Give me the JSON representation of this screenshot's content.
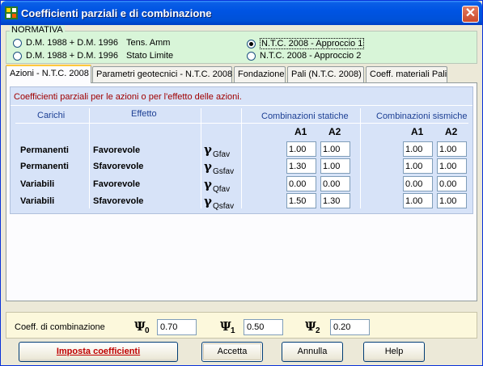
{
  "window": {
    "title": "Coefficienti parziali e di combinazione",
    "close_glyph": "✕"
  },
  "normativa": {
    "legend": "NORMATIVA",
    "options": [
      {
        "label": "D.M. 1988 + D.M. 1996",
        "detail": "Tens. Amm",
        "checked": false
      },
      {
        "label": "D.M. 1988 + D.M. 1996",
        "detail": "Stato Limite",
        "checked": false
      },
      {
        "label": "N.T.C. 2008 - Approccio 1",
        "detail": "",
        "checked": true
      },
      {
        "label": "N.T.C. 2008 - Approccio 2",
        "detail": "",
        "checked": false
      }
    ]
  },
  "tabs": [
    {
      "label": "Azioni - N.T.C. 2008",
      "active": true
    },
    {
      "label": "Parametri geotecnici - N.T.C. 2008",
      "active": false
    },
    {
      "label": "Fondazione",
      "active": false
    },
    {
      "label": "Pali (N.T.C. 2008)",
      "active": false
    },
    {
      "label": "Coeff. materiali Pali",
      "active": false
    }
  ],
  "azioni": {
    "caption": "Coefficienti parziali per le azioni o per l'effetto delle azioni.",
    "headers": {
      "carichi": "Carichi",
      "effetto": "Effetto",
      "statiche": "Combinazioni statiche",
      "sismiche": "Combinazioni sismiche",
      "a1": "A1",
      "a2": "A2"
    },
    "rows": [
      {
        "carico": "Permanenti",
        "effetto": "Favorevole",
        "gamma": "γ",
        "sub": "Gfav",
        "stat_a1": "1.00",
        "stat_a2": "1.00",
        "sism_a1": "1.00",
        "sism_a2": "1.00"
      },
      {
        "carico": "Permanenti",
        "effetto": "Sfavorevole",
        "gamma": "γ",
        "sub": "Gsfav",
        "stat_a1": "1.30",
        "stat_a2": "1.00",
        "sism_a1": "1.00",
        "sism_a2": "1.00"
      },
      {
        "carico": "Variabili",
        "effetto": "Favorevole",
        "gamma": "γ",
        "sub": "Qfav",
        "stat_a1": "0.00",
        "stat_a2": "0.00",
        "sism_a1": "0.00",
        "sism_a2": "0.00"
      },
      {
        "carico": "Variabili",
        "effetto": "Sfavorevole",
        "gamma": "γ",
        "sub": "Qsfav",
        "stat_a1": "1.50",
        "stat_a2": "1.30",
        "sism_a1": "1.00",
        "sism_a2": "1.00"
      }
    ]
  },
  "combinazione": {
    "label": "Coeff. di combinazione",
    "psi_symbol": "Ψ",
    "psi0": {
      "sub": "0",
      "value": "0.70"
    },
    "psi1": {
      "sub": "1",
      "value": "0.50"
    },
    "psi2": {
      "sub": "2",
      "value": "0.20"
    }
  },
  "buttons": {
    "imposta": "Imposta coefficienti",
    "accetta": "Accetta",
    "annulla": "Annulla",
    "help": "Help"
  }
}
